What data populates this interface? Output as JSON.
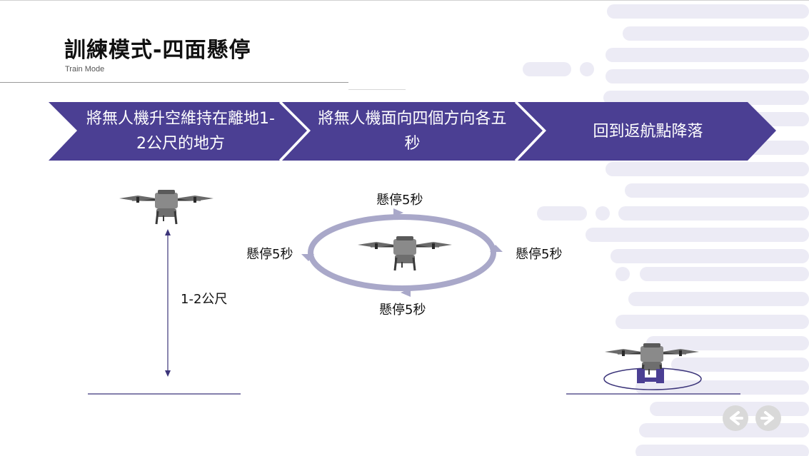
{
  "slide": {
    "title": "訓練模式-四面懸停",
    "subtitle": "Train Mode"
  },
  "steps": [
    {
      "text": "將無人機升空維持在離地1-2公尺的地方"
    },
    {
      "text": "將無人機面向四個方向各五秒"
    },
    {
      "text": "回到返航點降落"
    }
  ],
  "diagram": {
    "height_label": "1-2公尺",
    "hover_top": "懸停5秒",
    "hover_left": "懸停5秒",
    "hover_right": "懸停5秒",
    "hover_bottom": "懸停5秒"
  },
  "nav": {
    "prev_icon": "arrow-left-icon",
    "next_icon": "arrow-right-icon"
  },
  "colors": {
    "accent": "#4b3f93",
    "ring": "#a9a8c9",
    "deco": "#ecebf5",
    "line": "#3c357a"
  }
}
